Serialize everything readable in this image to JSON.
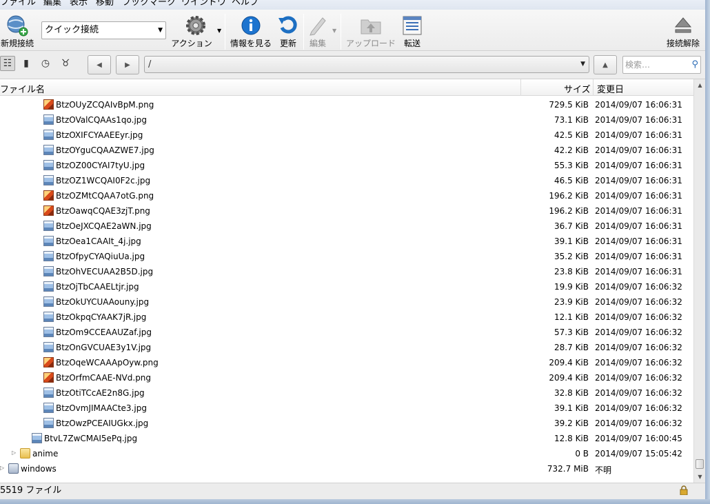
{
  "menu": [
    "ファイル",
    "編集",
    "表示",
    "移動",
    "ブックマーク",
    "ウインドウ",
    "ヘルプ"
  ],
  "toolbar": {
    "new_connection": "新規接続",
    "quick_connect": "クイック接続",
    "action": "アクション",
    "info": "情報を見る",
    "refresh": "更新",
    "edit": "編集",
    "upload": "アップロード",
    "transfer": "転送",
    "disconnect": "接続解除"
  },
  "nav": {
    "path": "/",
    "search_placeholder": "検索…"
  },
  "columns": {
    "name": "ファイル名",
    "size": "サイズ",
    "modified": "変更日"
  },
  "files": [
    {
      "name": "BtzOUyZCQAIvBpM.png",
      "type": "png",
      "size": "729.5 KiB",
      "date": "2014/09/07 16:06:31"
    },
    {
      "name": "BtzOValCQAAs1qo.jpg",
      "type": "jpg",
      "size": "73.1 KiB",
      "date": "2014/09/07 16:06:31"
    },
    {
      "name": "BtzOXIFCYAAEEyr.jpg",
      "type": "jpg",
      "size": "42.5 KiB",
      "date": "2014/09/07 16:06:31"
    },
    {
      "name": "BtzOYguCQAAZWE7.jpg",
      "type": "jpg",
      "size": "42.2 KiB",
      "date": "2014/09/07 16:06:31"
    },
    {
      "name": "BtzOZ00CYAI7tyU.jpg",
      "type": "jpg",
      "size": "55.3 KiB",
      "date": "2014/09/07 16:06:31"
    },
    {
      "name": "BtzOZ1WCQAI0F2c.jpg",
      "type": "jpg",
      "size": "46.5 KiB",
      "date": "2014/09/07 16:06:31"
    },
    {
      "name": "BtzOZMtCQAA7otG.png",
      "type": "png",
      "size": "196.2 KiB",
      "date": "2014/09/07 16:06:31"
    },
    {
      "name": "BtzOawqCQAE3zjT.png",
      "type": "png",
      "size": "196.2 KiB",
      "date": "2014/09/07 16:06:31"
    },
    {
      "name": "BtzOeJXCQAE2aWN.jpg",
      "type": "jpg",
      "size": "36.7 KiB",
      "date": "2014/09/07 16:06:31"
    },
    {
      "name": "BtzOea1CAAIt_4j.jpg",
      "type": "jpg",
      "size": "39.1 KiB",
      "date": "2014/09/07 16:06:31"
    },
    {
      "name": "BtzOfpyCYAQiuUa.jpg",
      "type": "jpg",
      "size": "35.2 KiB",
      "date": "2014/09/07 16:06:31"
    },
    {
      "name": "BtzOhVECUAA2B5D.jpg",
      "type": "jpg",
      "size": "23.8 KiB",
      "date": "2014/09/07 16:06:31"
    },
    {
      "name": "BtzOjTbCAAELtjr.jpg",
      "type": "jpg",
      "size": "19.9 KiB",
      "date": "2014/09/07 16:06:32"
    },
    {
      "name": "BtzOkUYCUAAouny.jpg",
      "type": "jpg",
      "size": "23.9 KiB",
      "date": "2014/09/07 16:06:32"
    },
    {
      "name": "BtzOkpqCYAAK7jR.jpg",
      "type": "jpg",
      "size": "12.1 KiB",
      "date": "2014/09/07 16:06:32"
    },
    {
      "name": "BtzOm9CCEAAUZaf.jpg",
      "type": "jpg",
      "size": "57.3 KiB",
      "date": "2014/09/07 16:06:32"
    },
    {
      "name": "BtzOnGVCUAE3y1V.jpg",
      "type": "jpg",
      "size": "28.7 KiB",
      "date": "2014/09/07 16:06:32"
    },
    {
      "name": "BtzOqeWCAAApOyw.png",
      "type": "png",
      "size": "209.4 KiB",
      "date": "2014/09/07 16:06:32"
    },
    {
      "name": "BtzOrfmCAAE-NVd.png",
      "type": "png",
      "size": "209.4 KiB",
      "date": "2014/09/07 16:06:32"
    },
    {
      "name": "BtzOtiTCcAE2n8G.jpg",
      "type": "jpg",
      "size": "32.8 KiB",
      "date": "2014/09/07 16:06:32"
    },
    {
      "name": "BtzOvmJIMAACte3.jpg",
      "type": "jpg",
      "size": "39.1 KiB",
      "date": "2014/09/07 16:06:32"
    },
    {
      "name": "BtzOwzPCEAIUGkx.jpg",
      "type": "jpg",
      "size": "39.2 KiB",
      "date": "2014/09/07 16:06:32"
    },
    {
      "name": "BtvL7ZwCMAI5ePq.jpg",
      "type": "jpg",
      "size": "12.8 KiB",
      "date": "2014/09/07 16:00:45",
      "level": 1
    },
    {
      "name": "anime",
      "type": "folder",
      "size": "0 B",
      "date": "2014/09/07 15:05:42",
      "level": 0,
      "expandable": true
    },
    {
      "name": "windows",
      "type": "drive",
      "size": "732.7 MiB",
      "date": "不明",
      "level": -1,
      "expandable": true
    }
  ],
  "status": {
    "file_count": "5519 ファイル"
  }
}
